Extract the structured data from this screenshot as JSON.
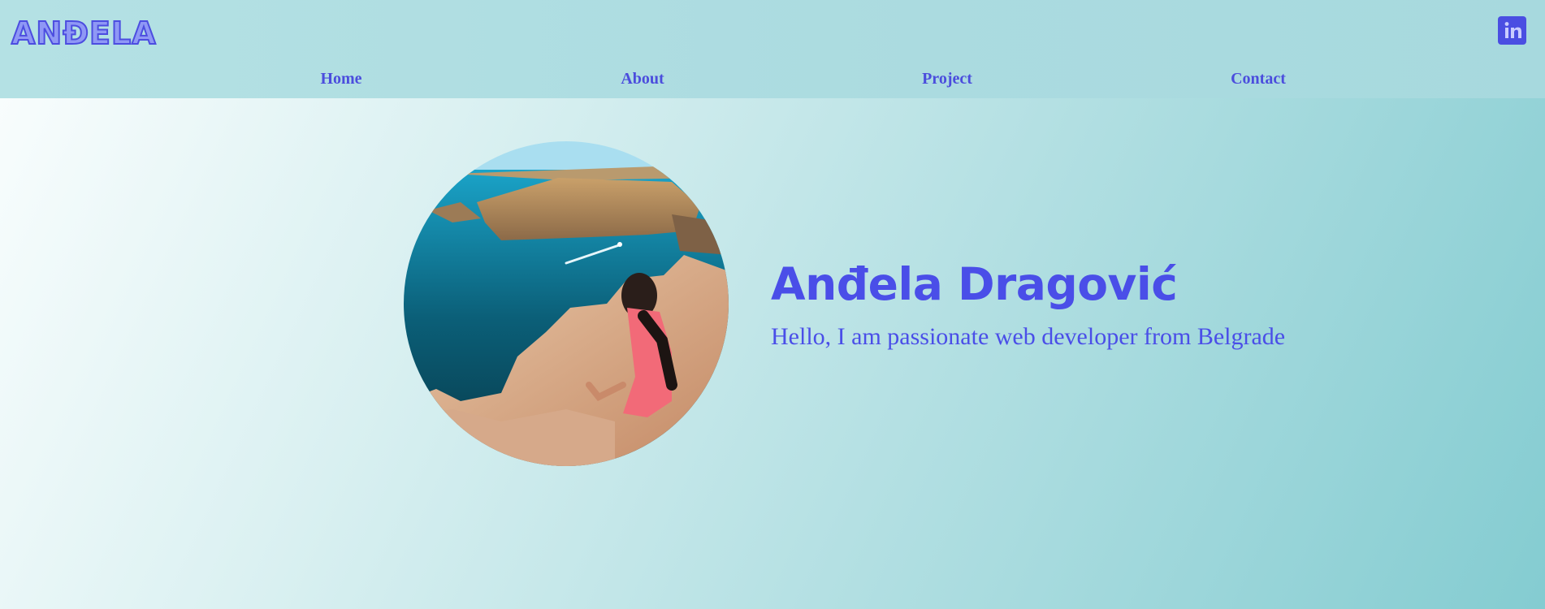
{
  "header": {
    "logo_text": "ANĐELA",
    "social_icon": "linkedin-icon"
  },
  "nav": {
    "items": [
      {
        "label": "Home"
      },
      {
        "label": "About"
      },
      {
        "label": "Project"
      },
      {
        "label": "Contact"
      }
    ]
  },
  "hero": {
    "name": "Anđela Dragović",
    "tagline": "Hello, I am passionate web developer from Belgrade",
    "photo_icon": "profile-photo"
  },
  "colors": {
    "accent": "#4a4ee8",
    "header_bg": "#addde1",
    "logo_fill": "#8f98f5"
  }
}
